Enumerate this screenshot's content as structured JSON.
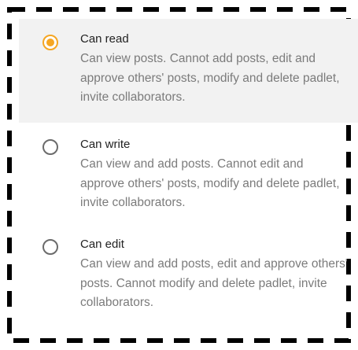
{
  "colors": {
    "accent": "#f5a623",
    "selected_background": "#f2f2f2",
    "frame": "#000000"
  },
  "options": [
    {
      "label": "Can read",
      "description": "Can view posts. Cannot add posts, edit and approve others' posts, modify and delete padlet, invite collaborators.",
      "selected": true
    },
    {
      "label": "Can write",
      "description": "Can view and add posts. Cannot edit and approve others' posts, modify and delete padlet, invite collaborators.",
      "selected": false
    },
    {
      "label": "Can edit",
      "description": "Can view and add posts, edit and approve others' posts. Cannot modify and delete padlet, invite collaborators.",
      "selected": false
    }
  ]
}
